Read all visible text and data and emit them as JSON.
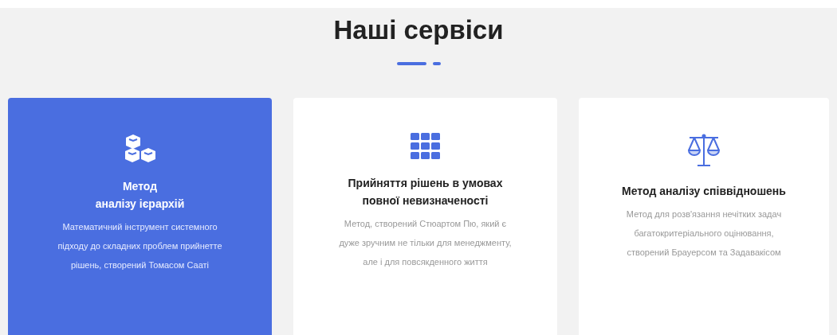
{
  "section": {
    "title": "Наші сервіси"
  },
  "services": [
    {
      "kind": "cubes",
      "title": "Метод\nаналізу ієрархій",
      "description": "Математичний інструмент системного підходу до складних проблем прийнетте рішень, створений Томасом Сааті",
      "selected": true
    },
    {
      "kind": "grid",
      "title": "Прийняття рішень в умовах повної невизначеності",
      "description": "Метод, створений Стюартом Пю, який є дуже зручним не тільки для менеджменту, але і для повсякденного життя",
      "selected": false
    },
    {
      "kind": "scale",
      "title": "Метод аналізу співвідношень",
      "description": "Метод для розв'язання нечітких задач багатокритеріального оцінювання, створений Брауерсом та Задавакісом",
      "selected": false
    }
  ]
}
